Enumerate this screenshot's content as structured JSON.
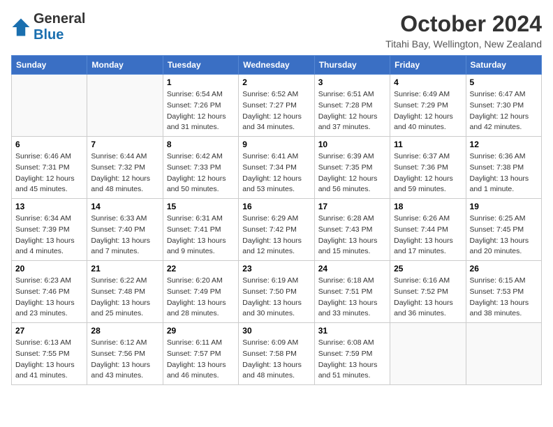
{
  "header": {
    "logo_general": "General",
    "logo_blue": "Blue",
    "month_title": "October 2024",
    "location": "Titahi Bay, Wellington, New Zealand"
  },
  "weekdays": [
    "Sunday",
    "Monday",
    "Tuesday",
    "Wednesday",
    "Thursday",
    "Friday",
    "Saturday"
  ],
  "weeks": [
    [
      {
        "day": "",
        "info": ""
      },
      {
        "day": "",
        "info": ""
      },
      {
        "day": "1",
        "info": "Sunrise: 6:54 AM\nSunset: 7:26 PM\nDaylight: 12 hours and 31 minutes."
      },
      {
        "day": "2",
        "info": "Sunrise: 6:52 AM\nSunset: 7:27 PM\nDaylight: 12 hours and 34 minutes."
      },
      {
        "day": "3",
        "info": "Sunrise: 6:51 AM\nSunset: 7:28 PM\nDaylight: 12 hours and 37 minutes."
      },
      {
        "day": "4",
        "info": "Sunrise: 6:49 AM\nSunset: 7:29 PM\nDaylight: 12 hours and 40 minutes."
      },
      {
        "day": "5",
        "info": "Sunrise: 6:47 AM\nSunset: 7:30 PM\nDaylight: 12 hours and 42 minutes."
      }
    ],
    [
      {
        "day": "6",
        "info": "Sunrise: 6:46 AM\nSunset: 7:31 PM\nDaylight: 12 hours and 45 minutes."
      },
      {
        "day": "7",
        "info": "Sunrise: 6:44 AM\nSunset: 7:32 PM\nDaylight: 12 hours and 48 minutes."
      },
      {
        "day": "8",
        "info": "Sunrise: 6:42 AM\nSunset: 7:33 PM\nDaylight: 12 hours and 50 minutes."
      },
      {
        "day": "9",
        "info": "Sunrise: 6:41 AM\nSunset: 7:34 PM\nDaylight: 12 hours and 53 minutes."
      },
      {
        "day": "10",
        "info": "Sunrise: 6:39 AM\nSunset: 7:35 PM\nDaylight: 12 hours and 56 minutes."
      },
      {
        "day": "11",
        "info": "Sunrise: 6:37 AM\nSunset: 7:36 PM\nDaylight: 12 hours and 59 minutes."
      },
      {
        "day": "12",
        "info": "Sunrise: 6:36 AM\nSunset: 7:38 PM\nDaylight: 13 hours and 1 minute."
      }
    ],
    [
      {
        "day": "13",
        "info": "Sunrise: 6:34 AM\nSunset: 7:39 PM\nDaylight: 13 hours and 4 minutes."
      },
      {
        "day": "14",
        "info": "Sunrise: 6:33 AM\nSunset: 7:40 PM\nDaylight: 13 hours and 7 minutes."
      },
      {
        "day": "15",
        "info": "Sunrise: 6:31 AM\nSunset: 7:41 PM\nDaylight: 13 hours and 9 minutes."
      },
      {
        "day": "16",
        "info": "Sunrise: 6:29 AM\nSunset: 7:42 PM\nDaylight: 13 hours and 12 minutes."
      },
      {
        "day": "17",
        "info": "Sunrise: 6:28 AM\nSunset: 7:43 PM\nDaylight: 13 hours and 15 minutes."
      },
      {
        "day": "18",
        "info": "Sunrise: 6:26 AM\nSunset: 7:44 PM\nDaylight: 13 hours and 17 minutes."
      },
      {
        "day": "19",
        "info": "Sunrise: 6:25 AM\nSunset: 7:45 PM\nDaylight: 13 hours and 20 minutes."
      }
    ],
    [
      {
        "day": "20",
        "info": "Sunrise: 6:23 AM\nSunset: 7:46 PM\nDaylight: 13 hours and 23 minutes."
      },
      {
        "day": "21",
        "info": "Sunrise: 6:22 AM\nSunset: 7:48 PM\nDaylight: 13 hours and 25 minutes."
      },
      {
        "day": "22",
        "info": "Sunrise: 6:20 AM\nSunset: 7:49 PM\nDaylight: 13 hours and 28 minutes."
      },
      {
        "day": "23",
        "info": "Sunrise: 6:19 AM\nSunset: 7:50 PM\nDaylight: 13 hours and 30 minutes."
      },
      {
        "day": "24",
        "info": "Sunrise: 6:18 AM\nSunset: 7:51 PM\nDaylight: 13 hours and 33 minutes."
      },
      {
        "day": "25",
        "info": "Sunrise: 6:16 AM\nSunset: 7:52 PM\nDaylight: 13 hours and 36 minutes."
      },
      {
        "day": "26",
        "info": "Sunrise: 6:15 AM\nSunset: 7:53 PM\nDaylight: 13 hours and 38 minutes."
      }
    ],
    [
      {
        "day": "27",
        "info": "Sunrise: 6:13 AM\nSunset: 7:55 PM\nDaylight: 13 hours and 41 minutes."
      },
      {
        "day": "28",
        "info": "Sunrise: 6:12 AM\nSunset: 7:56 PM\nDaylight: 13 hours and 43 minutes."
      },
      {
        "day": "29",
        "info": "Sunrise: 6:11 AM\nSunset: 7:57 PM\nDaylight: 13 hours and 46 minutes."
      },
      {
        "day": "30",
        "info": "Sunrise: 6:09 AM\nSunset: 7:58 PM\nDaylight: 13 hours and 48 minutes."
      },
      {
        "day": "31",
        "info": "Sunrise: 6:08 AM\nSunset: 7:59 PM\nDaylight: 13 hours and 51 minutes."
      },
      {
        "day": "",
        "info": ""
      },
      {
        "day": "",
        "info": ""
      }
    ]
  ]
}
